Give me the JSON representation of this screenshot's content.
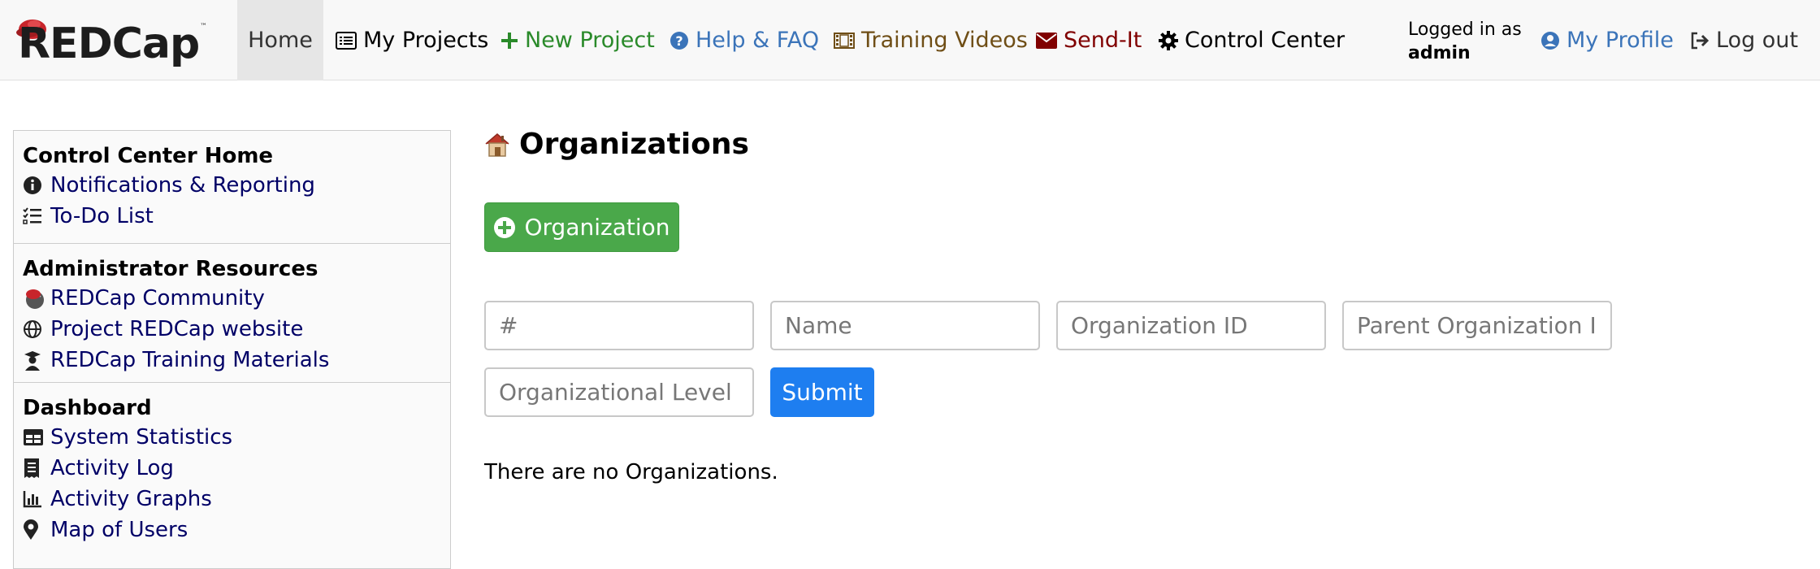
{
  "brand": {
    "logo_text": "REDCap",
    "tm": "™"
  },
  "nav": {
    "home": "Home",
    "my_projects": "My Projects",
    "new_project": "New Project",
    "help": "Help & FAQ",
    "training": "Training Videos",
    "send_it": "Send-It",
    "control_center": "Control Center",
    "logged_in_label": "Logged in as",
    "username": "admin",
    "my_profile": "My Profile",
    "log_out": "Log out"
  },
  "sidebar": {
    "section1": {
      "title": "Control Center Home",
      "items": [
        "Notifications & Reporting",
        "To-Do List"
      ]
    },
    "section2": {
      "title": "Administrator Resources",
      "items": [
        "REDCap Community",
        "Project REDCap website",
        "REDCap Training Materials"
      ]
    },
    "section3": {
      "title": "Dashboard",
      "items": [
        "System Statistics",
        "Activity Log",
        "Activity Graphs",
        "Map of Users"
      ]
    }
  },
  "main": {
    "title": "Organizations",
    "add_button": "Organization",
    "fields": {
      "number_placeholder": "#",
      "name_placeholder": "Name",
      "org_id_placeholder": "Organization ID",
      "parent_id_placeholder": "Parent Organization ID",
      "level_placeholder": "Organizational Level"
    },
    "submit": "Submit",
    "empty_message": "There are no Organizations."
  },
  "colors": {
    "add_button": "#4aa84a",
    "submit_button": "#1e7ef0",
    "sidebar_link": "#000066",
    "new_project": "#2a8a2a",
    "help": "#3b74b9",
    "send_it": "#800000"
  }
}
